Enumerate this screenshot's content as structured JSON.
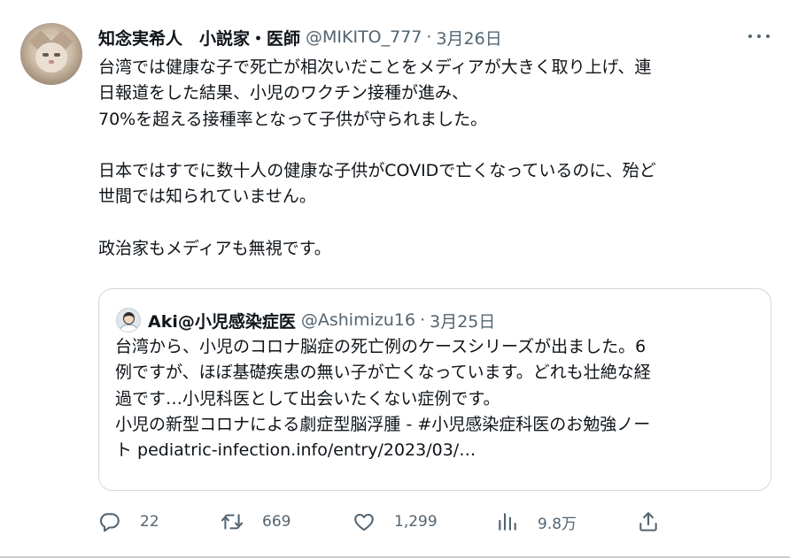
{
  "tweet": {
    "display_name": "知念実希人　小説家・医師",
    "handle": "@MIKITO_777",
    "separator": "·",
    "date": "3月26日",
    "avatar_icon": "cat-avatar-icon",
    "more_icon": "more-dots-icon",
    "lines": [
      "台湾では健康な子で死亡が相次いだことをメディアが大きく取り上げ、連",
      "日報道をした結果、小児のワクチン接種が進み、",
      "70%を超える接種率となって子供が守られました。",
      "",
      "日本ではすでに数十人の健康な子供がCOVIDで亡くなっているのに、殆ど",
      "世間では知られていません。",
      "",
      "政治家もメディアも無視です。"
    ]
  },
  "quoted": {
    "display_name": "Aki@小児感染症医",
    "handle": "@Ashimizu16",
    "separator": "·",
    "date": "3月25日",
    "avatar_icon": "doctor-avatar-icon",
    "lines": [
      "台湾から、小児のコロナ脳症の死亡例のケースシリーズが出ました。6",
      "例ですが、ほぼ基礎疾患の無い子が亡くなっています。どれも壮絶な経",
      "過です…小児科医として出会いたくない症例です。",
      "小児の新型コロナによる劇症型脳浮腫 - #小児感染症科医のお勉強ノー",
      "ト pediatric-infection.info/entry/2023/03/…"
    ]
  },
  "actions": {
    "reply": {
      "count": "22",
      "icon": "reply-icon"
    },
    "retweet": {
      "count": "669",
      "icon": "retweet-icon"
    },
    "like": {
      "count": "1,299",
      "icon": "heart-icon"
    },
    "views": {
      "count": "9.8万",
      "icon": "views-chart-icon"
    },
    "share": {
      "icon": "share-icon"
    }
  },
  "colors": {
    "text": "#0f1419",
    "secondary": "#536471",
    "border": "#cfd9de"
  }
}
